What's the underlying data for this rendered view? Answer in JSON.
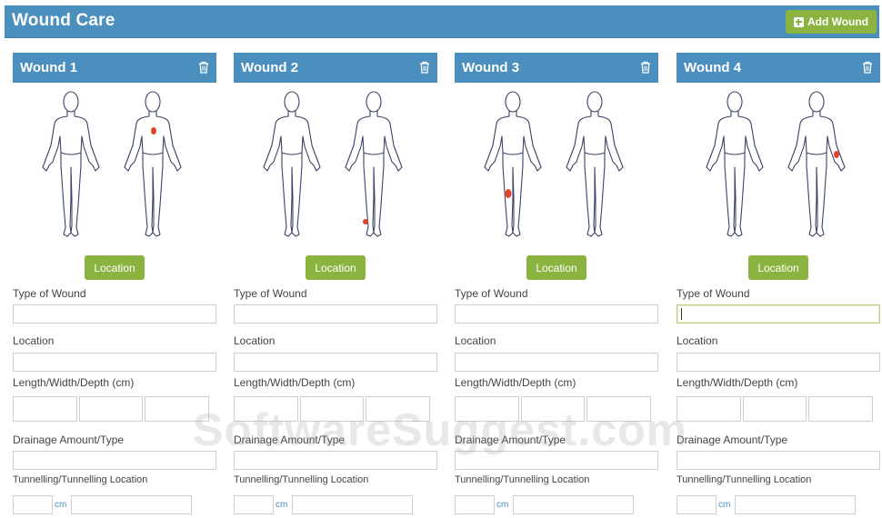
{
  "header": {
    "title": "Wound Care",
    "add_button_label": "Add Wound"
  },
  "wounds": [
    {
      "title": "Wound 1",
      "location_button": "Location",
      "marker": "back-chest-right"
    },
    {
      "title": "Wound 2",
      "location_button": "Location",
      "marker": "back-ankle-left"
    },
    {
      "title": "Wound 3",
      "location_button": "Location",
      "marker": "front-knee-right"
    },
    {
      "title": "Wound 4",
      "location_button": "Location",
      "marker": "back-forearm-right"
    }
  ],
  "labels": {
    "type_of_wound": "Type of Wound",
    "location": "Location",
    "lwd": "Length/Width/Depth (cm)",
    "drainage": "Drainage Amount/Type",
    "tunnelling": "Tunnelling/Tunnelling Location",
    "unit": "cm"
  },
  "watermark": "SoftwareSuggest.com",
  "colors": {
    "header_blue": "#4a8fbd",
    "button_green": "#8ab43f",
    "marker_red": "#e0452b"
  },
  "icons": {
    "add": "plus-square-icon",
    "delete": "trash-icon"
  }
}
